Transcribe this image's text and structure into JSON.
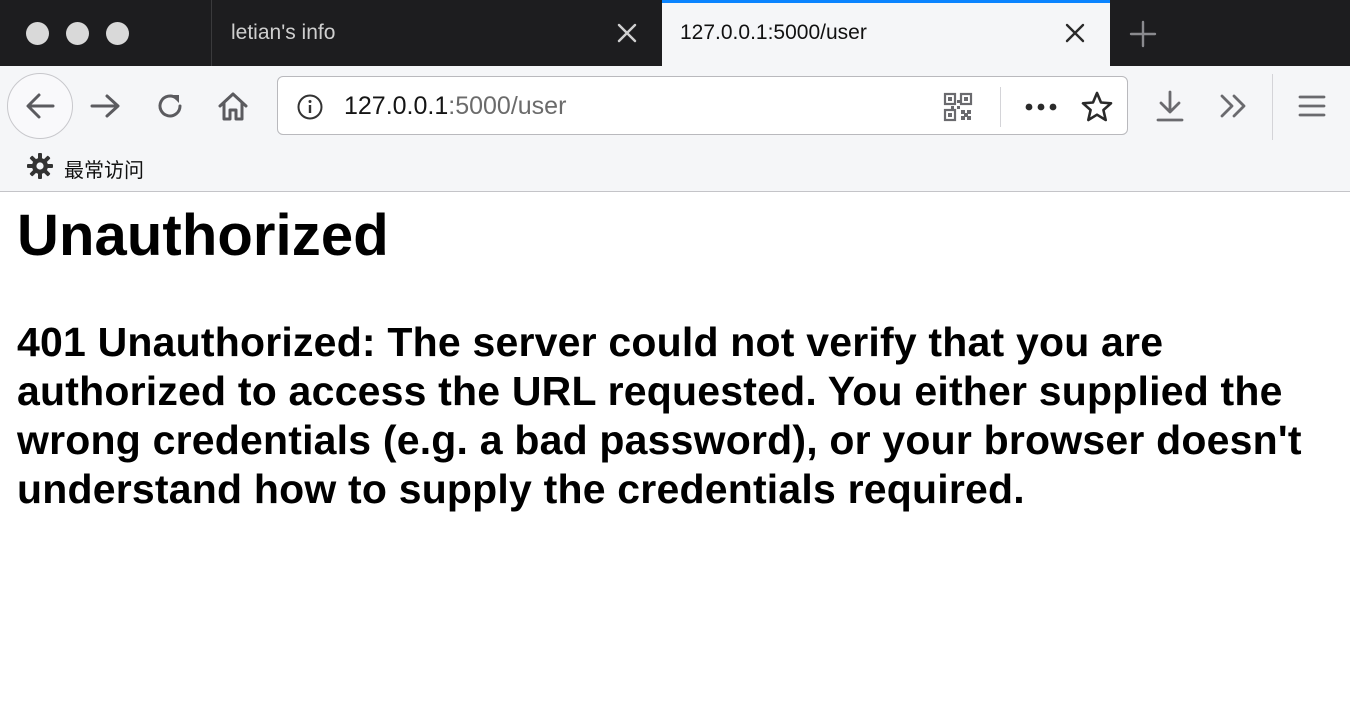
{
  "browser": {
    "tabs": [
      {
        "title": "letian's info",
        "active": false
      },
      {
        "title": "127.0.0.1:5000/user",
        "active": true
      }
    ],
    "address_bar": {
      "host": "127.0.0.1",
      "rest": ":5000/user"
    },
    "bookmarks": [
      {
        "label": "最常访问",
        "icon": "gear-icon"
      }
    ],
    "colors": {
      "tabstrip": "#1d1d1f",
      "active_tab_accent": "#0a84ff",
      "toolbar": "#f5f6f8"
    }
  },
  "page": {
    "heading": "Unauthorized",
    "message": "401 Unauthorized: The server could not verify that you are authorized to access the URL requested. You either supplied the wrong credentials (e.g. a bad password), or your browser doesn't understand how to supply the credentials required."
  }
}
